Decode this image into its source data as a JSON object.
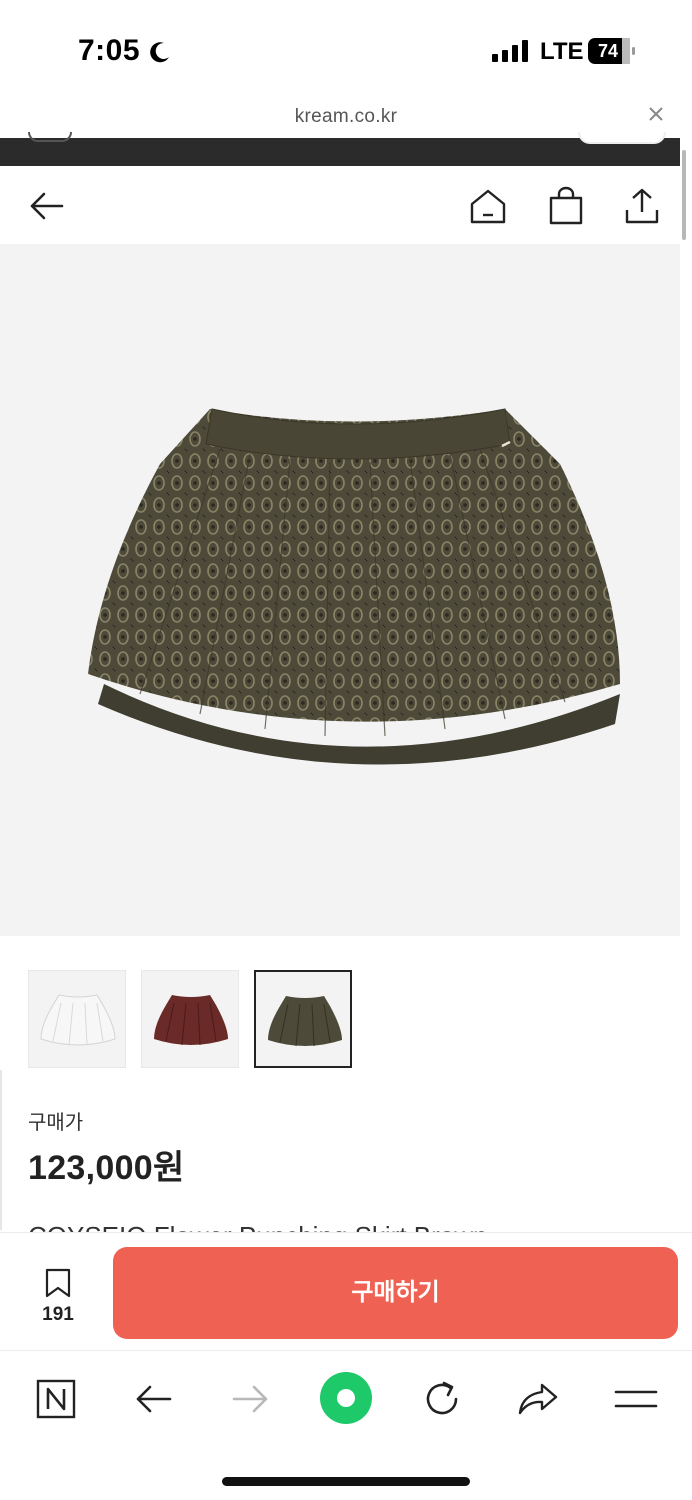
{
  "status_bar": {
    "time": "7:05",
    "network": "LTE",
    "battery": "74"
  },
  "browser": {
    "url": "kream.co.kr"
  },
  "header": {
    "back_icon": "arrow-left-icon",
    "home_icon": "home-icon",
    "cart_icon": "shopping-bag-icon",
    "share_icon": "share-icon"
  },
  "product": {
    "image_alt": "brown punching skirt",
    "thumbnails": [
      {
        "color": "white"
      },
      {
        "color": "burgundy"
      },
      {
        "color": "brown",
        "selected": true
      }
    ],
    "price_label": "구매가",
    "price": "123,000원",
    "name_partial": "COYSEIO Flower Punching Skirt Brown"
  },
  "buy_bar": {
    "wish_count": "191",
    "buy_label": "구매하기"
  },
  "colors": {
    "buy_button": "#ef6253",
    "hero_bg": "#f3f3f3",
    "skirt_brown": "#4e4a3a",
    "nav_green": "#1ec96a"
  },
  "toolbar": {
    "icons": [
      "naver-n-icon",
      "back-arrow-icon",
      "forward-arrow-icon",
      "green-dot-icon",
      "refresh-icon",
      "share-arrow-icon",
      "menu-icon"
    ]
  }
}
